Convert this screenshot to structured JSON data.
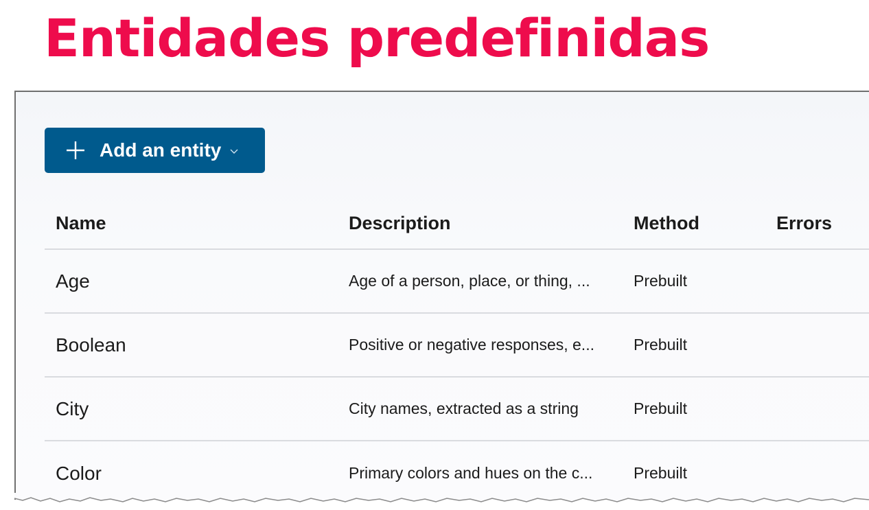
{
  "slide": {
    "title": "Entidades predefinidas"
  },
  "toolbar": {
    "add_entity_label": "Add an entity",
    "add_icon": "plus-icon",
    "dropdown_icon": "chevron-down-icon"
  },
  "table": {
    "columns": {
      "name": "Name",
      "description": "Description",
      "method": "Method",
      "errors": "Errors"
    },
    "rows": [
      {
        "name": "Age",
        "description": "Age of a person, place, or thing, ...",
        "method": "Prebuilt",
        "errors": ""
      },
      {
        "name": "Boolean",
        "description": "Positive or negative responses, e...",
        "method": "Prebuilt",
        "errors": ""
      },
      {
        "name": "City",
        "description": "City names, extracted as a string",
        "method": "Prebuilt",
        "errors": ""
      },
      {
        "name": "Color",
        "description": "Primary colors and hues on the c...",
        "method": "Prebuilt",
        "errors": ""
      }
    ]
  },
  "colors": {
    "title": "#ee0c4c",
    "button": "#005a8d",
    "divider": "#d9dbdf"
  }
}
